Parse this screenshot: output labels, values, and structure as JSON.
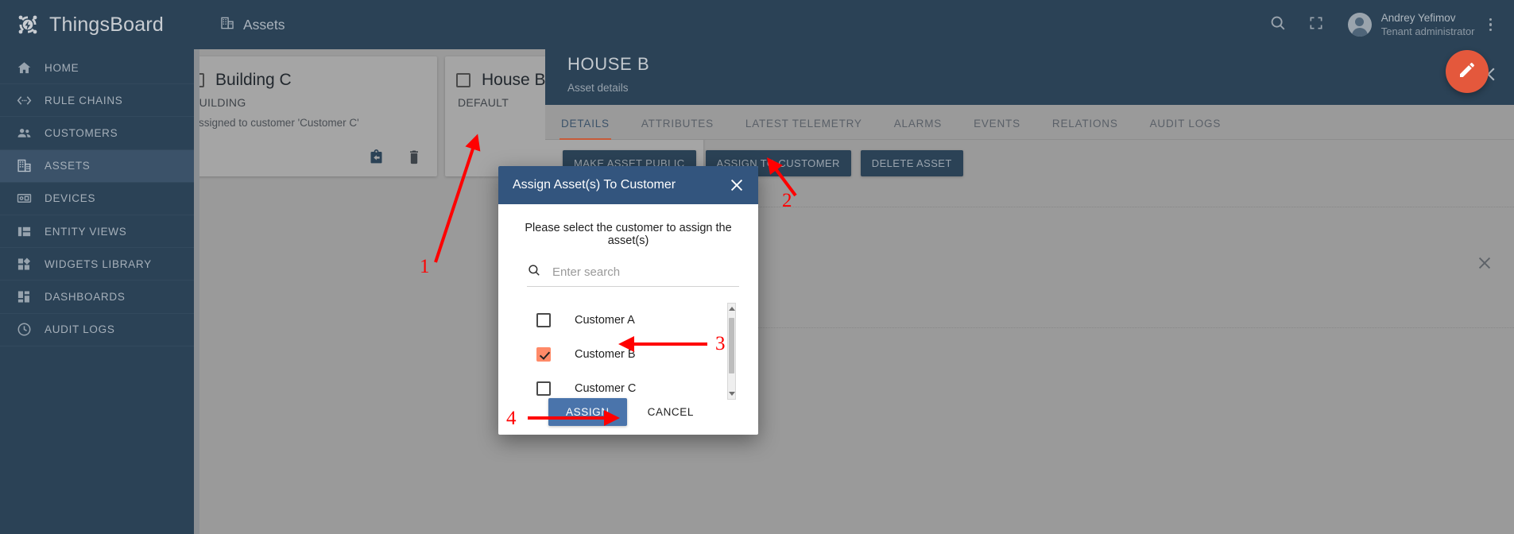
{
  "brand": {
    "name": "ThingsBoard",
    "logo_icon": "thingsboard-logo-icon"
  },
  "sidebar": {
    "items": [
      {
        "label": "HOME",
        "icon": "home-icon",
        "active": false
      },
      {
        "label": "RULE CHAINS",
        "icon": "rule-chains-icon",
        "active": false
      },
      {
        "label": "CUSTOMERS",
        "icon": "customers-icon",
        "active": false
      },
      {
        "label": "ASSETS",
        "icon": "assets-icon",
        "active": true
      },
      {
        "label": "DEVICES",
        "icon": "devices-icon",
        "active": false
      },
      {
        "label": "ENTITY VIEWS",
        "icon": "entity-views-icon",
        "active": false
      },
      {
        "label": "WIDGETS LIBRARY",
        "icon": "widgets-library-icon",
        "active": false
      },
      {
        "label": "DASHBOARDS",
        "icon": "dashboards-icon",
        "active": false
      },
      {
        "label": "AUDIT LOGS",
        "icon": "audit-logs-icon",
        "active": false
      }
    ]
  },
  "topbar": {
    "page_title": "Assets",
    "page_icon": "assets-icon",
    "search_icon": "search-icon",
    "fullscreen_icon": "fullscreen-icon",
    "avatar_icon": "user-avatar-icon",
    "user_name": "Andrey Yefimov",
    "user_role": "Tenant administrator",
    "overflow_icon": "more-vert-icon"
  },
  "cards": [
    {
      "title": "Building C",
      "type": "BUILDING",
      "note": "Assigned to customer 'Customer C'",
      "checked": false,
      "actions": [
        {
          "name": "unassign-from-customer",
          "icon": "unassign-icon"
        },
        {
          "name": "delete-asset",
          "icon": "trash-icon"
        }
      ]
    },
    {
      "title": "House B",
      "type": "DEFAULT",
      "note": "",
      "checked": false,
      "actions": []
    }
  ],
  "details": {
    "title": "HOUSE B",
    "subtitle": "Asset details",
    "help_icon": "help-icon",
    "close_icon": "close-icon",
    "help_label": "?",
    "tabs": [
      {
        "label": "DETAILS",
        "active": true
      },
      {
        "label": "ATTRIBUTES",
        "active": false
      },
      {
        "label": "LATEST TELEMETRY",
        "active": false
      },
      {
        "label": "ALARMS",
        "active": false
      },
      {
        "label": "EVENTS",
        "active": false
      },
      {
        "label": "RELATIONS",
        "active": false
      },
      {
        "label": "AUDIT LOGS",
        "active": false
      }
    ],
    "actions": [
      {
        "label": "MAKE ASSET PUBLIC"
      },
      {
        "label": "ASSIGN TO CUSTOMER"
      },
      {
        "label": "DELETE ASSET"
      }
    ],
    "edit_fab_icon": "pencil-icon",
    "panel_close_icon": "close-icon"
  },
  "dialog": {
    "title": "Assign Asset(s) To Customer",
    "close_icon": "close-icon",
    "prompt": "Please select the customer to assign the asset(s)",
    "search_icon": "search-icon",
    "search_placeholder": "Enter search",
    "search_value": "",
    "customers": [
      {
        "label": "Customer A",
        "checked": false
      },
      {
        "label": "Customer B",
        "checked": true
      },
      {
        "label": "Customer C",
        "checked": false
      }
    ],
    "assign_label": "ASSIGN",
    "cancel_label": "CANCEL"
  },
  "annotations": {
    "color": "#ff0000",
    "steps": [
      {
        "number": "1"
      },
      {
        "number": "2"
      },
      {
        "number": "3"
      },
      {
        "number": "4"
      }
    ]
  },
  "colors": {
    "nav_bg": "#2b4256",
    "accent_orange": "#c75b39",
    "fab": "#e4583c",
    "dialog_header": "#33557e",
    "assign_button": "#4a74ab",
    "checkbox_checked": "#ff8a68",
    "canvas": "#9a9a9a"
  }
}
